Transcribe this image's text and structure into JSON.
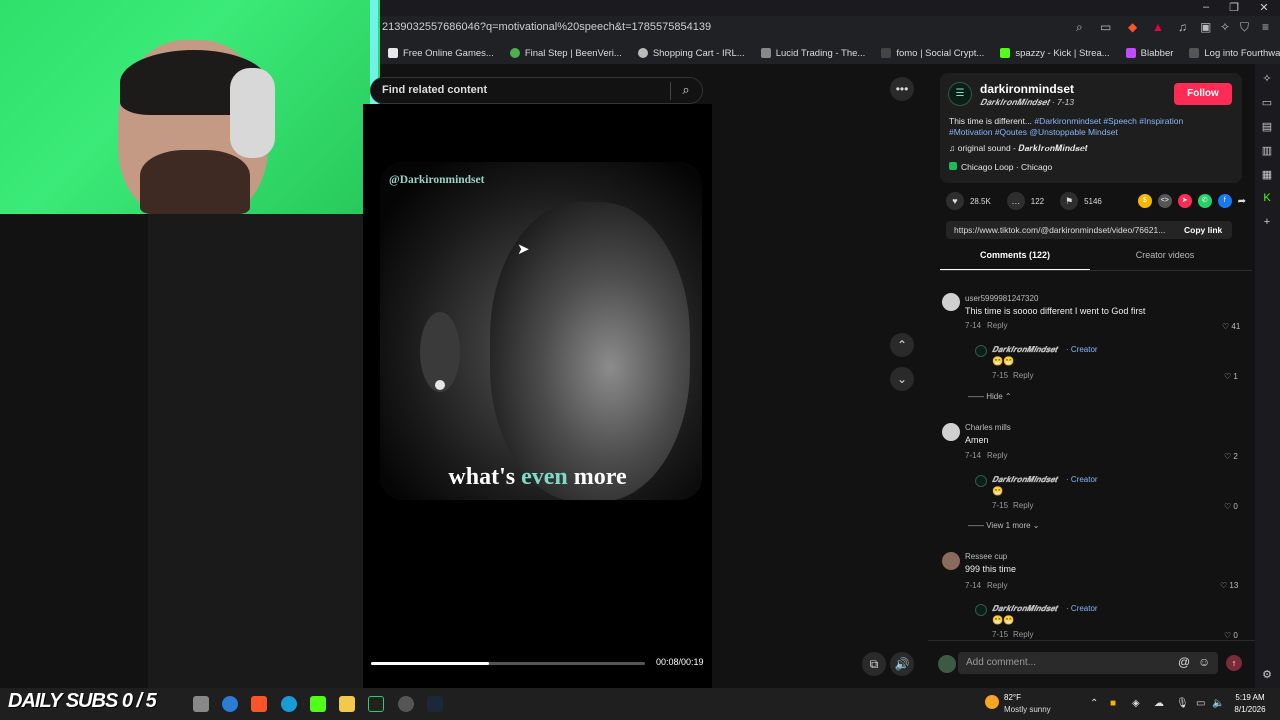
{
  "browser": {
    "url": "2139032557686046?q=motivational%20speech&t=1785575854139",
    "bookmarks": [
      {
        "label": "Free Online Games...",
        "color": "#e8e8e8"
      },
      {
        "label": "Final Step | BeenVeri...",
        "color": "#4caf50"
      },
      {
        "label": "Shopping Cart - IRL...",
        "color": "#bbbbbb"
      },
      {
        "label": "Lucid Trading - The...",
        "color": "#888888"
      },
      {
        "label": "fomo | Social Crypt...",
        "color": "#333333"
      },
      {
        "label": "spazzy - Kick | Strea...",
        "color": "#53fc18"
      },
      {
        "label": "Blabber",
        "color": "#c04cff"
      },
      {
        "label": "Log into Fourthwall...",
        "color": "#222222"
      }
    ],
    "window_controls": [
      "–",
      "❐",
      "✕"
    ]
  },
  "search": {
    "placeholder": "Find related content"
  },
  "video": {
    "watermark": "@Darkironmindset",
    "caption_before": "what's ",
    "caption_highlight": "even",
    "caption_after": " more",
    "time": "00:08/00:19",
    "progress": 0.43
  },
  "creator": {
    "username": "darkironmindset",
    "display_name_date": "𝑫𝒂𝒓𝒌𝑰𝒓𝒐𝒏𝑴𝒊𝒏𝒅𝒔𝒆𝒕 · 7-13",
    "follow_label": "Follow",
    "description_text": "This time is different... ",
    "description_tags_line1": "#Darkironmindset #Speech #Inspiration",
    "description_tags_line2": "#Motivation #Qoutes @Unstoppable Mindset",
    "sound": "original sound - 𝑫𝒂𝒓𝒌𝑰𝒓𝒐𝒏𝑴𝒊𝒏𝒅𝒔𝒆𝒕",
    "location": "Chicago Loop · Chicago"
  },
  "stats": {
    "likes": "28.5K",
    "comments": "122",
    "saves": "5146"
  },
  "share_colors": [
    "#f5b800",
    "#555555",
    "#fe2c55",
    "#25d366",
    "#1877f2"
  ],
  "link": {
    "url": "https://www.tiktok.com/@darkironmindset/video/76621...",
    "copy_label": "Copy link"
  },
  "tabs": {
    "comments": "Comments (122)",
    "creator_videos": "Creator videos"
  },
  "comments": [
    {
      "user": "user5999981247320",
      "text": "This time is soooo different I went to God first",
      "date": "7-14",
      "reply": "Reply",
      "likes": "41",
      "reply_item": {
        "name": "𝑫𝒂𝒓𝒌𝑰𝒓𝒐𝒏𝑴𝒊𝒏𝒅𝒔𝒆𝒕",
        "tag": "· Creator",
        "emoji": "😁😁",
        "date": "7-15",
        "reply": "Reply",
        "likes": "1"
      },
      "toggle": "Hide ⌃"
    },
    {
      "user": "Charles mills",
      "text": "Amen",
      "date": "7-14",
      "reply": "Reply",
      "likes": "2",
      "reply_item": {
        "name": "𝑫𝒂𝒓𝒌𝑰𝒓𝒐𝒏𝑴𝒊𝒏𝒅𝒔𝒆𝒕",
        "tag": "· Creator",
        "emoji": "😁",
        "date": "7-15",
        "reply": "Reply",
        "likes": "0"
      },
      "toggle": "View 1 more ⌄"
    },
    {
      "user": "Ressee cup",
      "text": "999 this time",
      "date": "7-14",
      "reply": "Reply",
      "likes": "13",
      "reply_item": {
        "name": "𝑫𝒂𝒓𝒌𝑰𝒓𝒐𝒏𝑴𝒊𝒏𝒅𝒔𝒆𝒕",
        "tag": "· Creator",
        "emoji": "😁😁",
        "date": "7-15",
        "reply": "Reply",
        "likes": "0"
      }
    }
  ],
  "comment_input": {
    "placeholder": "Add comment..."
  },
  "taskbar": {
    "overlay_text": "DAILY SUBS 0 / 5",
    "temp": "82°F",
    "weather": "Mostly sunny",
    "time": "5:19 AM",
    "date": "8/1/2026"
  }
}
